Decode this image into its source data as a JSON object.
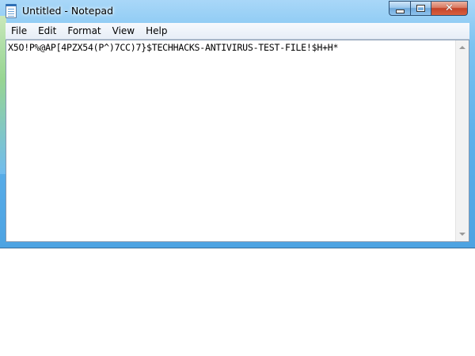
{
  "window": {
    "title": "Untitled - Notepad",
    "controls": {
      "minimize_icon": "minimize-icon",
      "maximize_icon": "maximize-icon",
      "close_icon": "close-icon",
      "close_label": "✕"
    }
  },
  "menu": {
    "items": [
      {
        "label": "File"
      },
      {
        "label": "Edit"
      },
      {
        "label": "Format"
      },
      {
        "label": "View"
      },
      {
        "label": "Help"
      }
    ]
  },
  "editor": {
    "content": "X5O!P%@AP[4PZX54(P^)7CC)7}$TECHHACKS-ANTIVIRUS-TEST-FILE!$H+H*"
  },
  "colors": {
    "titlebar": "#7cc3f1",
    "close_button": "#c4432a",
    "editor_background": "#ffffff"
  }
}
